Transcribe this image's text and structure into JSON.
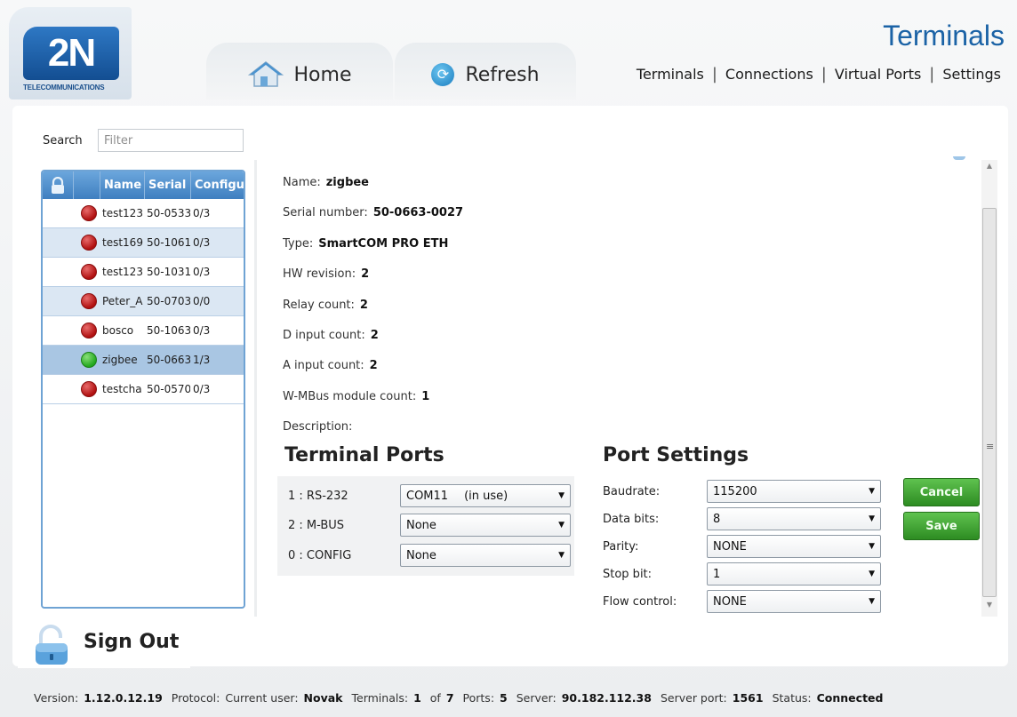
{
  "app": {
    "logo_text": "2N",
    "logo_tagline": "TELECOMMUNICATIONS",
    "page_title": "Terminals",
    "accent_color": "#1b63a6"
  },
  "tabs": [
    {
      "label": "Home",
      "icon": "home-icon"
    },
    {
      "label": "Refresh",
      "icon": "refresh-icon"
    }
  ],
  "topnav": [
    "Terminals",
    "Connections",
    "Virtual Ports",
    "Settings"
  ],
  "search": {
    "label": "Search",
    "placeholder": "Filter",
    "value": ""
  },
  "terminal_list": {
    "columns": [
      "Name",
      "Serial n",
      "Configu"
    ],
    "rows": [
      {
        "name": "test123",
        "serial": "50-0533",
        "config": "0/3",
        "status": "red"
      },
      {
        "name": "test169",
        "serial": "50-1061",
        "config": "0/3",
        "status": "red"
      },
      {
        "name": "test123",
        "serial": "50-1031",
        "config": "0/3",
        "status": "red"
      },
      {
        "name": "Peter_A",
        "serial": "50-0703",
        "config": "0/0",
        "status": "red"
      },
      {
        "name": "bosco",
        "serial": "50-1063",
        "config": "0/3",
        "status": "red"
      },
      {
        "name": "zigbee",
        "serial": "50-0663",
        "config": "1/3",
        "status": "green"
      },
      {
        "name": "testcha",
        "serial": "50-0570",
        "config": "0/3",
        "status": "red"
      }
    ],
    "selected_index": 5
  },
  "details": [
    {
      "label": "Name:",
      "value": "zigbee"
    },
    {
      "label": "Serial number:",
      "value": "50-0663-0027"
    },
    {
      "label": "Type:",
      "value": "SmartCOM PRO ETH"
    },
    {
      "label": "HW revision:",
      "value": "2"
    },
    {
      "label": "Relay count:",
      "value": "2"
    },
    {
      "label": "D input count:",
      "value": "2"
    },
    {
      "label": "A input count:",
      "value": "2"
    },
    {
      "label": "W-MBus module count:",
      "value": "1"
    },
    {
      "label": "Description:",
      "value": ""
    }
  ],
  "terminal_ports": {
    "title": "Terminal Ports",
    "rows": [
      {
        "label": "1  :  RS-232",
        "value": "COM11",
        "note": "(in use)"
      },
      {
        "label": "2  :  M-BUS",
        "value": "None",
        "note": ""
      },
      {
        "label": "0  :  CONFIG",
        "value": "None",
        "note": ""
      }
    ]
  },
  "port_settings": {
    "title": "Port Settings",
    "rows": [
      {
        "label": "Baudrate:",
        "value": "115200"
      },
      {
        "label": "Data bits:",
        "value": "8"
      },
      {
        "label": "Parity:",
        "value": "NONE"
      },
      {
        "label": "Stop bit:",
        "value": "1"
      },
      {
        "label": "Flow control:",
        "value": "NONE"
      }
    ]
  },
  "buttons": {
    "cancel": "Cancel",
    "save": "Save"
  },
  "signout": {
    "label": "Sign Out"
  },
  "status": {
    "version_label": "Version:",
    "version": "1.12.0.12.19",
    "protocol_label": "Protocol:",
    "user_label": "Current user:",
    "user": "Novak",
    "terminals_label": "Terminals:",
    "terminals_count": "1",
    "terminals_of": "of",
    "terminals_total": "7",
    "ports_label": "Ports:",
    "ports": "5",
    "server_label": "Server:",
    "server": "90.182.112.38",
    "server_port_label": "Server port:",
    "server_port": "1561",
    "status_label": "Status:",
    "status": "Connected"
  }
}
